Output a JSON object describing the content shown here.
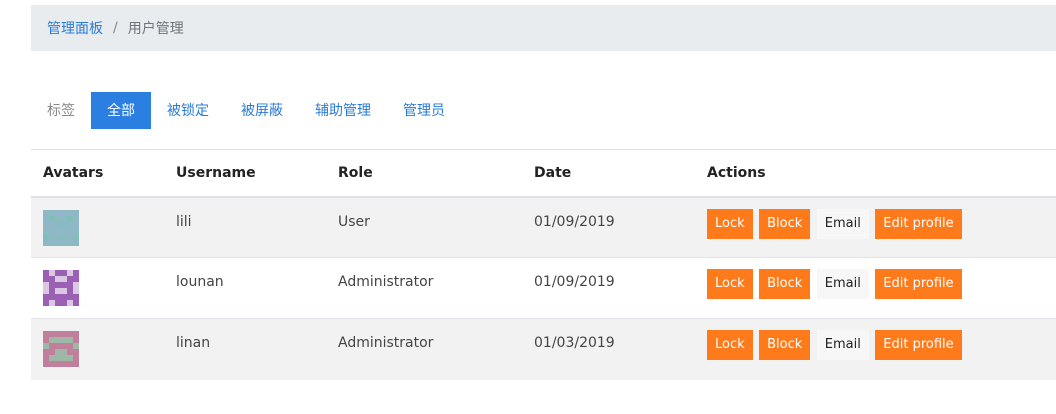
{
  "breadcrumb": {
    "home": "管理面板",
    "separator": "/",
    "current": "用户管理"
  },
  "filter": {
    "title": "标签",
    "tabs": [
      "全部",
      "被锁定",
      "被屏蔽",
      "辅助管理",
      "管理员"
    ]
  },
  "table": {
    "headers": [
      "Avatars",
      "Username",
      "Role",
      "Date",
      "Actions"
    ],
    "rows": [
      {
        "username": "lili",
        "role": "User",
        "date": "01/09/2019"
      },
      {
        "username": "lounan",
        "role": "Administrator",
        "date": "01/09/2019"
      },
      {
        "username": "linan",
        "role": "Administrator",
        "date": "01/03/2019"
      }
    ],
    "actions": {
      "lock": "Lock",
      "block": "Block",
      "email": "Email",
      "edit": "Edit profile"
    }
  },
  "colors": {
    "accent": "#2a7fe0",
    "action": "#ff7a1a"
  }
}
